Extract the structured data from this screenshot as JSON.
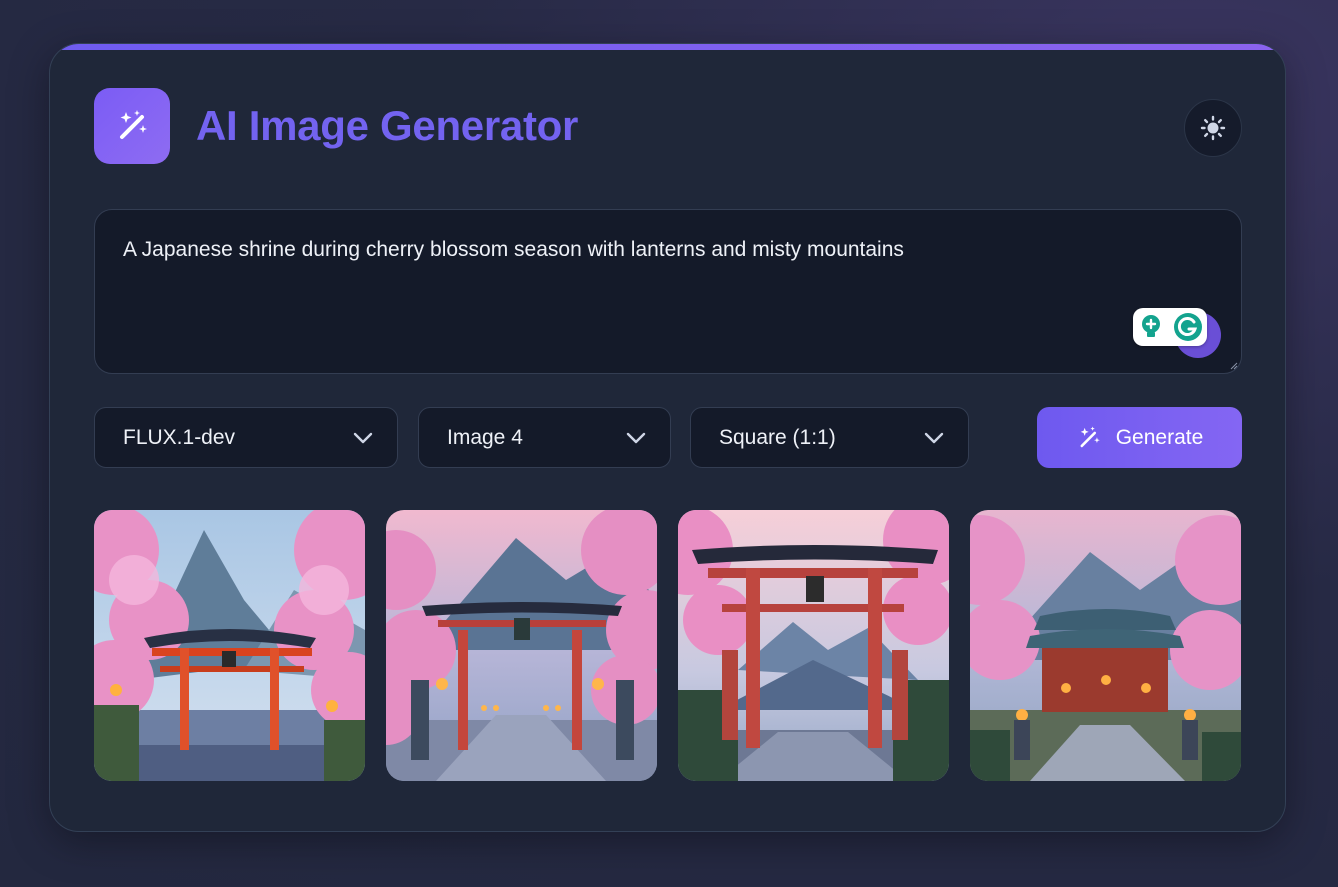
{
  "app": {
    "title": "AI Image Generator",
    "logo_icon": "magic-wand-icon",
    "theme_toggle_icon": "sun-icon",
    "accent_color": "#7363f0"
  },
  "prompt": {
    "value": "A Japanese shrine during cherry blossom season with lanterns and misty mountains",
    "extension_icon": "grammarly-icon"
  },
  "controls": {
    "model": {
      "selected": "FLUX.1-dev",
      "icon": "chevron-down-icon"
    },
    "count": {
      "selected": "Image 4",
      "icon": "chevron-down-icon"
    },
    "aspect": {
      "selected": "Square (1:1)",
      "icon": "chevron-down-icon"
    },
    "generate": {
      "label": "Generate",
      "icon": "magic-wand-icon",
      "color": "#7a60f2"
    }
  },
  "gallery": {
    "images": [
      {
        "subject": "torii gate by water with cherry blossoms"
      },
      {
        "subject": "torii gate over stone path lined with lanterns"
      },
      {
        "subject": "tall torii gate framing distant mountains"
      },
      {
        "subject": "shrine hall with glowing lanterns and blossoms"
      }
    ]
  }
}
